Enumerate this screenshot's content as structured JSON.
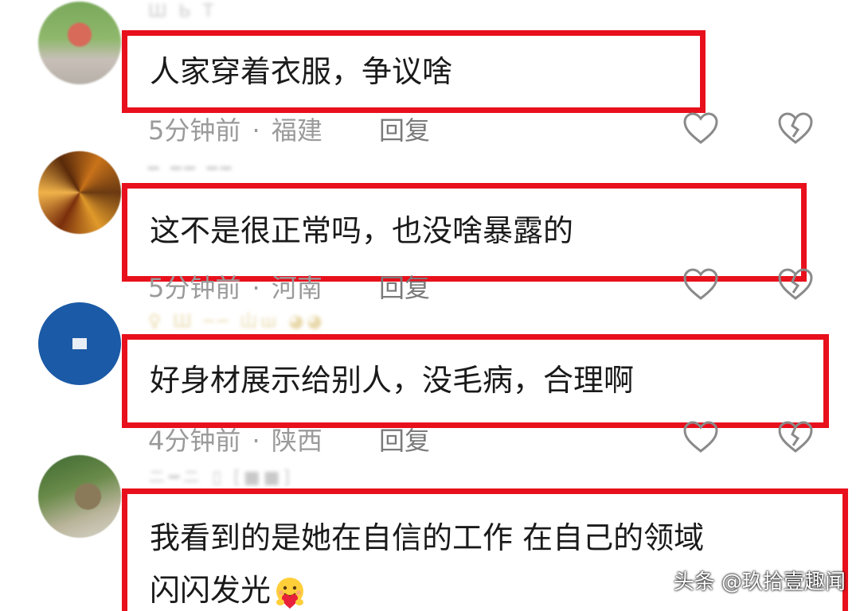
{
  "comments": [
    {
      "username": "Ш Ь Т",
      "text": "人家穿着衣服，争议啥",
      "time": "5分钟前",
      "separator": "·",
      "region": "福建",
      "reply_label": "回复"
    },
    {
      "username": "━ ━━ ━━",
      "text": "这不是很正常吗，也没啥暴露的",
      "time": "5分钟前",
      "separator": "·",
      "region": "河南",
      "reply_label": "回复"
    },
    {
      "username": "♀ Ш ── 山ш ◕◕",
      "text": "好身材展示给别人，没毛病，合理啊",
      "time": "4分钟前",
      "separator": "·",
      "region": "陕西",
      "reply_label": "回复"
    },
    {
      "username": "ニ━ニ ▯ [■■]",
      "text_line1": "我看到的是她在自信的工作 在自己的领域",
      "text_line2": "闪闪发光",
      "emoji": "hugging-face-emoji"
    }
  ],
  "watermark": "头条 @玖拾壹趣闻",
  "colors": {
    "highlight_border": "#e8101c",
    "meta_text": "#9a9a9a",
    "comment_text": "#1a1a1a"
  }
}
